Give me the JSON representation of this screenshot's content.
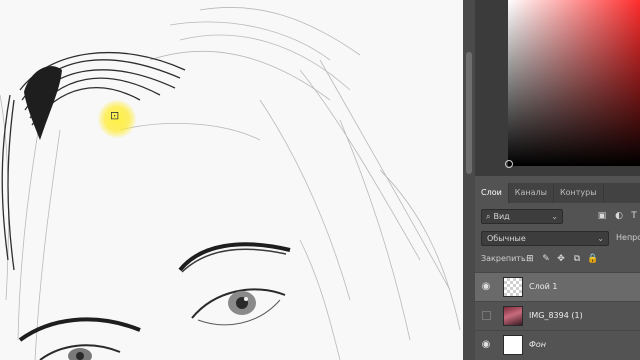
{
  "colors": {
    "panel_bg": "#535353",
    "tab_bar": "#424242",
    "selected_layer": "#6a6a6a",
    "picker_hue": "#ff2d2d",
    "cursor_highlight": "#ffeb32"
  },
  "tabs": [
    {
      "label": "Слои",
      "active": true
    },
    {
      "label": "Каналы",
      "active": false
    },
    {
      "label": "Контуры",
      "active": false
    }
  ],
  "filter": {
    "icon": "search-icon",
    "value": "Вид"
  },
  "blend": {
    "value": "Обычные",
    "opacity_label": "Непрозр"
  },
  "lock": {
    "label": "Закрепить:"
  },
  "layers": [
    {
      "name": "Слой 1",
      "visible": true,
      "selected": true,
      "thumb": "transparent"
    },
    {
      "name": "IMG_8394 (1)",
      "visible": false,
      "selected": false,
      "thumb": "photo"
    },
    {
      "name": "Фон",
      "visible": true,
      "selected": false,
      "thumb": "white"
    }
  ]
}
